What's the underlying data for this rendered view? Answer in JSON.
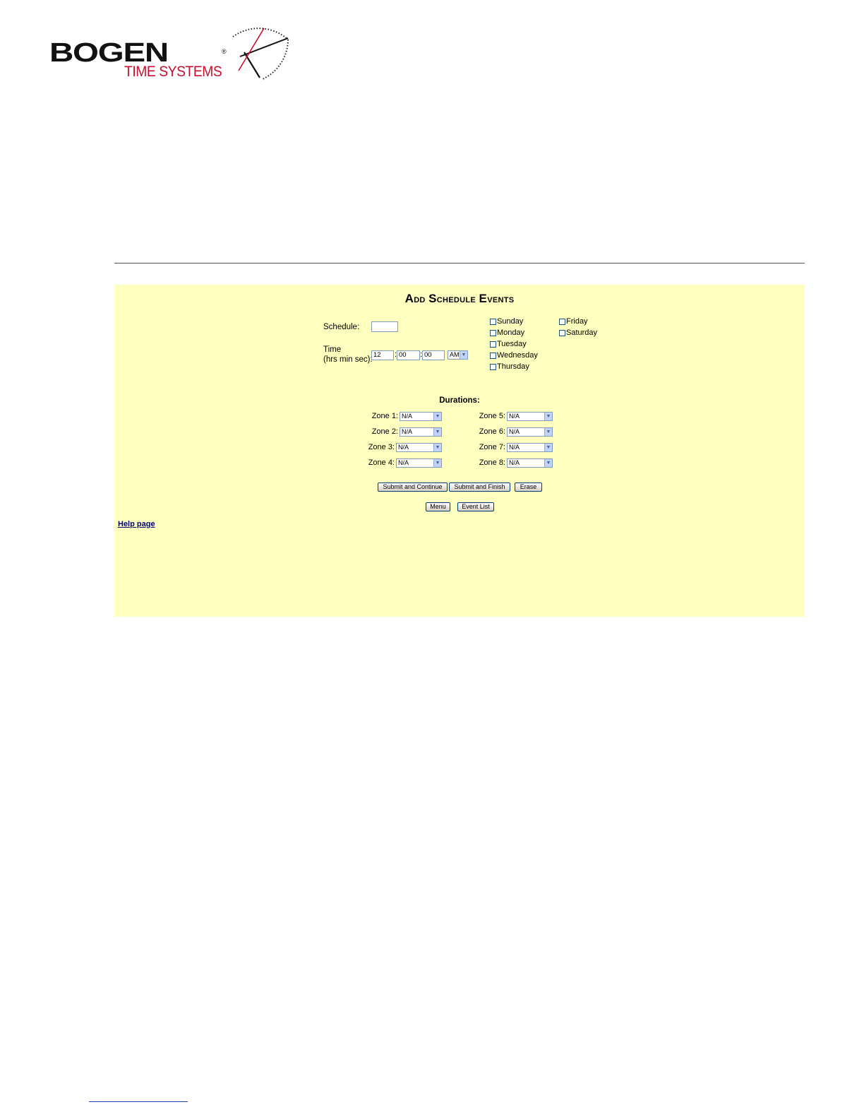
{
  "brand": {
    "name": "BOGEN",
    "registered": "®",
    "subtitle": "TIME SYSTEMS"
  },
  "form": {
    "title_first_letter_1": "A",
    "title_rest_1": "dd",
    "title_first_letter_2": "S",
    "title_rest_2": "chedule",
    "title_first_letter_3": "E",
    "title_rest_3": "vents",
    "schedule_label": "Schedule:",
    "schedule_value": "",
    "time_label_line1": "Time",
    "time_label_line2": "(hrs min sec):",
    "time_hours": "12",
    "time_minutes": "00",
    "time_seconds": "00",
    "time_ampm": "AM",
    "days": [
      "Sunday",
      "Monday",
      "Tuesday",
      "Wednesday",
      "Thursday",
      "Friday",
      "Saturday"
    ],
    "durations_label": "Durations:",
    "zones": [
      {
        "label": "Zone 1:",
        "value": "N/A"
      },
      {
        "label": "Zone 2:",
        "value": "N/A"
      },
      {
        "label": "Zone 3:",
        "value": "N/A"
      },
      {
        "label": "Zone 4:",
        "value": "N/A"
      },
      {
        "label": "Zone 5:",
        "value": "N/A"
      },
      {
        "label": "Zone 6:",
        "value": "N/A"
      },
      {
        "label": "Zone 7:",
        "value": "N/A"
      },
      {
        "label": "Zone 8:",
        "value": "N/A"
      }
    ],
    "buttons": {
      "submit_continue": "Submit and Continue",
      "submit_finish": "Submit and Finish",
      "erase": "Erase",
      "menu": "Menu",
      "event_list": "Event List"
    },
    "help_link": "Help page"
  },
  "colors": {
    "panel_bg": "#ffffc0",
    "brand_red": "#c8102e"
  }
}
